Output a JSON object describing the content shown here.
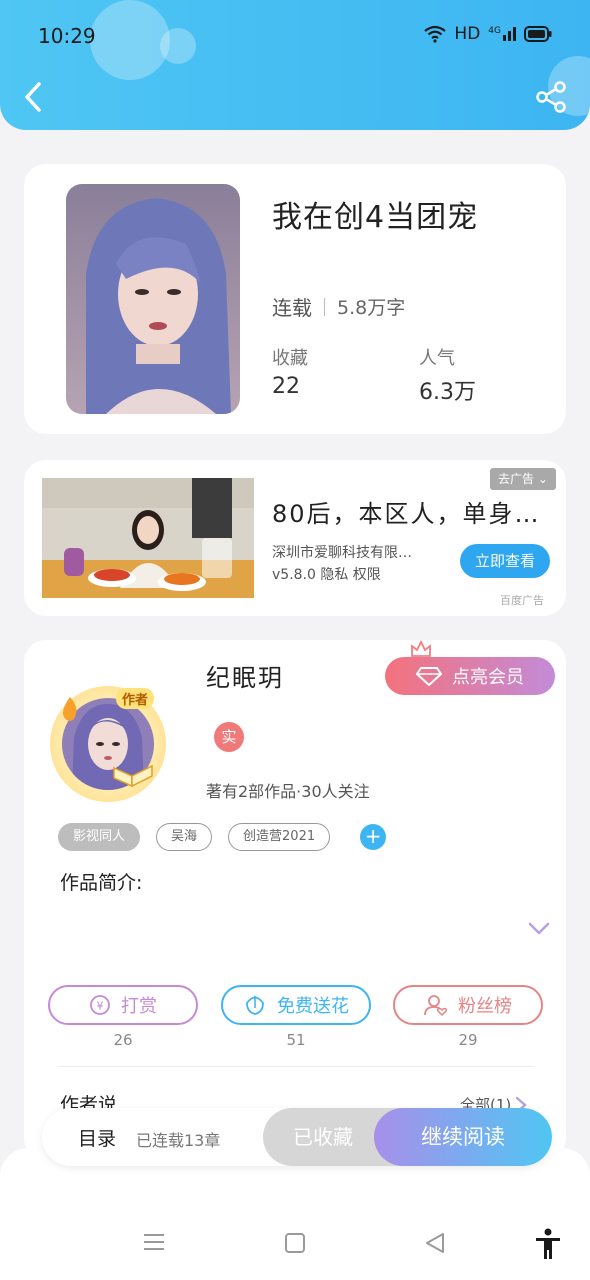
{
  "status_bar": {
    "time": "10:29",
    "network": "HD",
    "signal_label": "4G"
  },
  "header": {
    "back_icon": "chevron-left-icon",
    "share_icon": "share-icon"
  },
  "book": {
    "title": "我在创4当团宠",
    "status": "连载",
    "word_count": "5.8万字",
    "collect_label": "收藏",
    "collect_value": "22",
    "popularity_label": "人气",
    "popularity_value": "6.3万"
  },
  "ad": {
    "title": "80后，本区人，单身…",
    "company": "深圳市爱聊科技有限…",
    "version_info": "v5.8.0  隐私  权限",
    "cta": "立即查看",
    "close_label": "去广告",
    "source": "百度广告"
  },
  "author": {
    "name": "纪眠玥",
    "badge": "作者",
    "vip_label": "点亮会员",
    "real_badge": "实",
    "stats": "著有2部作品·30人关注",
    "tags": [
      "影视同人",
      "吴海",
      "创造营2021"
    ],
    "intro_label": "作品简介:",
    "actions": [
      {
        "label": "打赏",
        "count": "26",
        "icon": "yuan-coin-icon",
        "color": "#c48ad6"
      },
      {
        "label": "免费送花",
        "count": "51",
        "icon": "flower-icon",
        "color": "#3db5f2"
      },
      {
        "label": "粉丝榜",
        "count": "29",
        "icon": "fan-user-icon",
        "color": "#e58585"
      }
    ],
    "says_label": "作者说",
    "all_link": "全部(1)"
  },
  "bottom_bar": {
    "toc_label": "目录",
    "toc_status": "已连载13章",
    "collected_label": "已收藏",
    "continue_label": "继续阅读"
  },
  "colors": {
    "accent": "#3db5f2",
    "header_bg": "#4fc6f3",
    "vip_gradient_start": "#f4727c",
    "vip_gradient_end": "#c38bd8"
  }
}
